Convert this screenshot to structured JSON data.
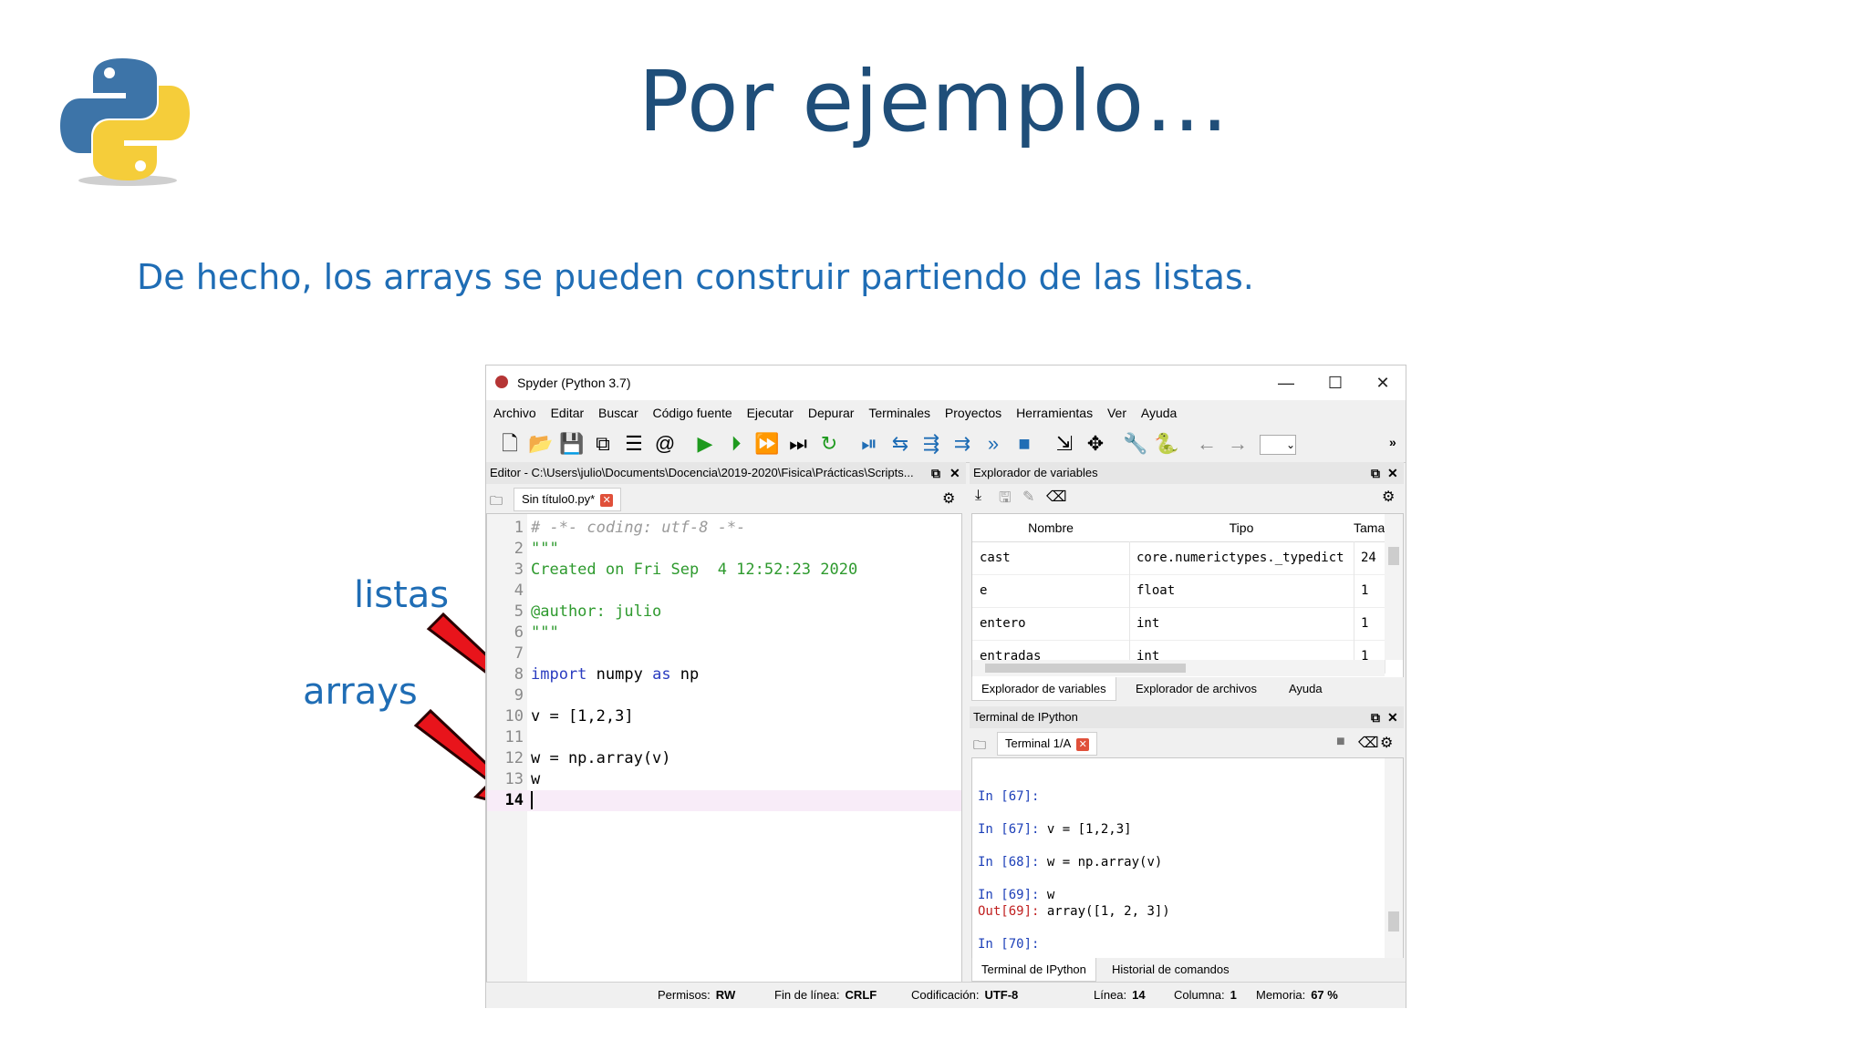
{
  "slide": {
    "title": "Por ejemplo…",
    "subtitle": "De hecho, los arrays se pueden construir partiendo de las listas.",
    "annotation_listas": "listas",
    "annotation_arrays": "arrays"
  },
  "window": {
    "title": "Spyder (Python 3.7)",
    "controls": {
      "minimize": "—",
      "maximize": "☐",
      "close": "✕"
    }
  },
  "menu": [
    "Archivo",
    "Editar",
    "Buscar",
    "Código fuente",
    "Ejecutar",
    "Depurar",
    "Terminales",
    "Proyectos",
    "Herramientas",
    "Ver",
    "Ayuda"
  ],
  "editor": {
    "header": "Editor - C:\\Users\\julio\\Documents\\Docencia\\2019-2020\\Fisica\\Prácticas\\Scripts...",
    "tab_label": "Sin título0.py*",
    "lines": [
      {
        "n": "1",
        "text": "# -*- coding: utf-8 -*-"
      },
      {
        "n": "2",
        "text": "\"\"\""
      },
      {
        "n": "3",
        "text": "Created on Fri Sep  4 12:52:23 2020"
      },
      {
        "n": "4",
        "text": ""
      },
      {
        "n": "5",
        "text": "@author: julio"
      },
      {
        "n": "6",
        "text": "\"\"\""
      },
      {
        "n": "7",
        "text": ""
      },
      {
        "n": "8",
        "text": "import numpy as np"
      },
      {
        "n": "9",
        "text": ""
      },
      {
        "n": "10",
        "text": "v = [1,2,3]"
      },
      {
        "n": "11",
        "text": ""
      },
      {
        "n": "12",
        "text": "w = np.array(v)"
      },
      {
        "n": "13",
        "text": "w"
      },
      {
        "n": "14",
        "text": ""
      }
    ]
  },
  "variables": {
    "header": "Explorador de variables",
    "columns": [
      "Nombre",
      "Tipo",
      "Tamaño"
    ],
    "rows": [
      {
        "name": "cast",
        "type": "core.numerictypes._typedict",
        "size": "24"
      },
      {
        "name": "e",
        "type": "float",
        "size": "1"
      },
      {
        "name": "entero",
        "type": "int",
        "size": "1"
      },
      {
        "name": "entradas",
        "type": "int",
        "size": "1"
      }
    ],
    "tabs": [
      "Explorador de variables",
      "Explorador de archivos",
      "Ayuda"
    ]
  },
  "terminal": {
    "header": "Terminal de IPython",
    "tab_label": "Terminal 1/A",
    "lines": [
      {
        "prompt": "In [67]:",
        "text": ""
      },
      {
        "prompt": "In [67]:",
        "text": " v = [1,2,3]"
      },
      {
        "prompt": "In [68]:",
        "text": " w = np.array(v)"
      },
      {
        "prompt": "In [69]:",
        "text": " w"
      },
      {
        "prompt": "Out[69]:",
        "text": " array([1, 2, 3])"
      },
      {
        "prompt": "In [70]:",
        "text": ""
      }
    ],
    "bottom_tabs": [
      "Terminal de IPython",
      "Historial de comandos"
    ]
  },
  "status": {
    "permisos_label": "Permisos:",
    "permisos": "RW",
    "fin_linea_label": "Fin de línea:",
    "fin_linea": "CRLF",
    "codificacion_label": "Codificación:",
    "codificacion": "UTF-8",
    "linea_label": "Línea:",
    "linea": "14",
    "columna_label": "Columna:",
    "columna": "1",
    "memoria_label": "Memoria:",
    "memoria": "67 %"
  },
  "colors": {
    "title": "#1f4e79",
    "accent_blue": "#1f6db5",
    "arrow_red": "#e8141b",
    "comment": "#9a9a9a",
    "string_green": "#2e9a2e",
    "keyword_blue": "#2a3cc0",
    "prompt_blue": "#1c3fb8",
    "prompt_red": "#c02020"
  }
}
